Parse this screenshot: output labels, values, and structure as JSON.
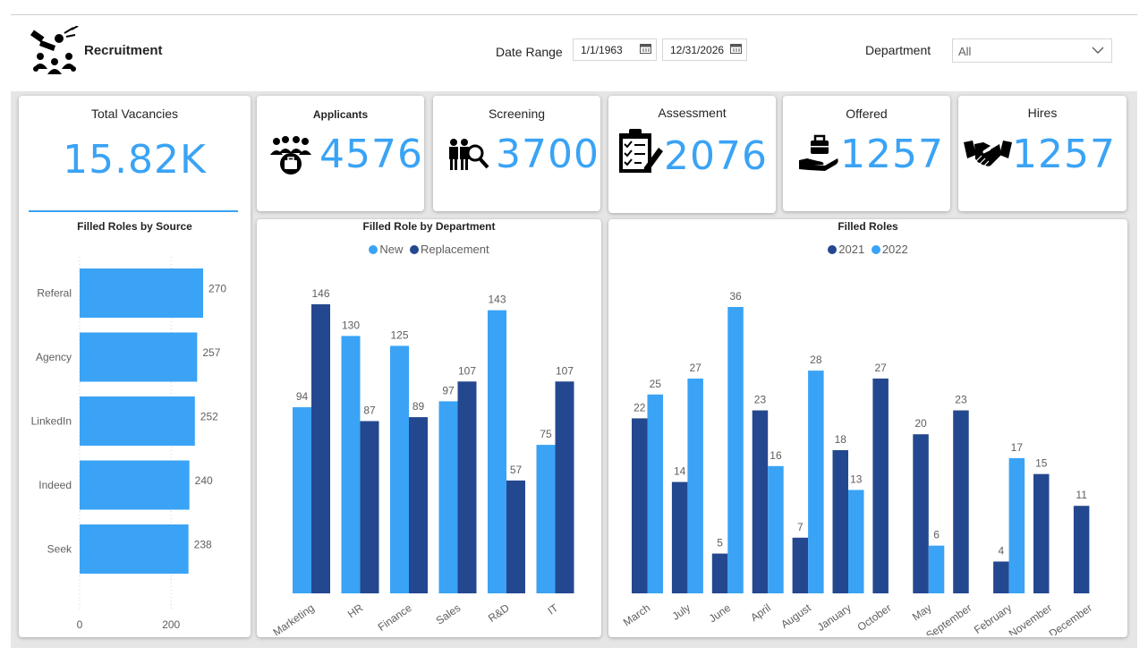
{
  "header": {
    "title": "Recruitment",
    "date_range_label": "Date Range",
    "date_start": "1/1/1963",
    "date_end": "12/31/2026",
    "department_label": "Department",
    "department_value": "All"
  },
  "kpis": {
    "total_vacancies": {
      "label": "Total Vacancies",
      "value": "15.82K"
    },
    "applicants": {
      "label": "Applicants",
      "value": "4576",
      "icon": "group-briefcase-icon"
    },
    "screening": {
      "label": "Screening",
      "value": "3700",
      "icon": "people-search-icon"
    },
    "assessment": {
      "label": "Assessment",
      "value": "2076",
      "icon": "clipboard-checklist-icon"
    },
    "offered": {
      "label": "Offered",
      "value": "1257",
      "icon": "hand-briefcase-icon"
    },
    "hires": {
      "label": "Hires",
      "value": "1257",
      "icon": "handshake-icon"
    }
  },
  "colors": {
    "accent": "#3aa3f5",
    "dark_series": "#24488f",
    "light_series": "#3aa3f5"
  },
  "chart_data": [
    {
      "type": "bar",
      "orientation": "horizontal",
      "title": "Filled Roles by Source",
      "categories": [
        "Referal",
        "Agency",
        "LinkedIn",
        "Indeed",
        "Seek"
      ],
      "values": [
        270,
        257,
        252,
        240,
        238
      ],
      "xticks": [
        "0",
        "200"
      ],
      "xlim": [
        0,
        270
      ]
    },
    {
      "type": "bar",
      "title": "Filled Role by Department",
      "categories": [
        "Marketing",
        "HR",
        "Finance",
        "Sales",
        "R&D",
        "IT"
      ],
      "series": [
        {
          "name": "New",
          "values": [
            94,
            130,
            125,
            97,
            143,
            75
          ]
        },
        {
          "name": "Replacement",
          "values": [
            146,
            87,
            89,
            107,
            57,
            107
          ]
        }
      ],
      "legend": "top-center",
      "ylim": [
        0,
        146
      ]
    },
    {
      "type": "bar",
      "title": "Filled Roles",
      "categories": [
        "March",
        "July",
        "June",
        "April",
        "August",
        "January",
        "October",
        "May",
        "September",
        "February",
        "November",
        "December"
      ],
      "series": [
        {
          "name": "2021",
          "values": [
            22,
            14,
            5,
            23,
            7,
            18,
            27,
            20,
            23,
            4,
            15,
            11
          ]
        },
        {
          "name": "2022",
          "values": [
            25,
            27,
            36,
            16,
            28,
            13,
            null,
            6,
            null,
            17,
            null,
            null
          ]
        }
      ],
      "legend": "top-center",
      "ylim": [
        0,
        36
      ]
    }
  ]
}
